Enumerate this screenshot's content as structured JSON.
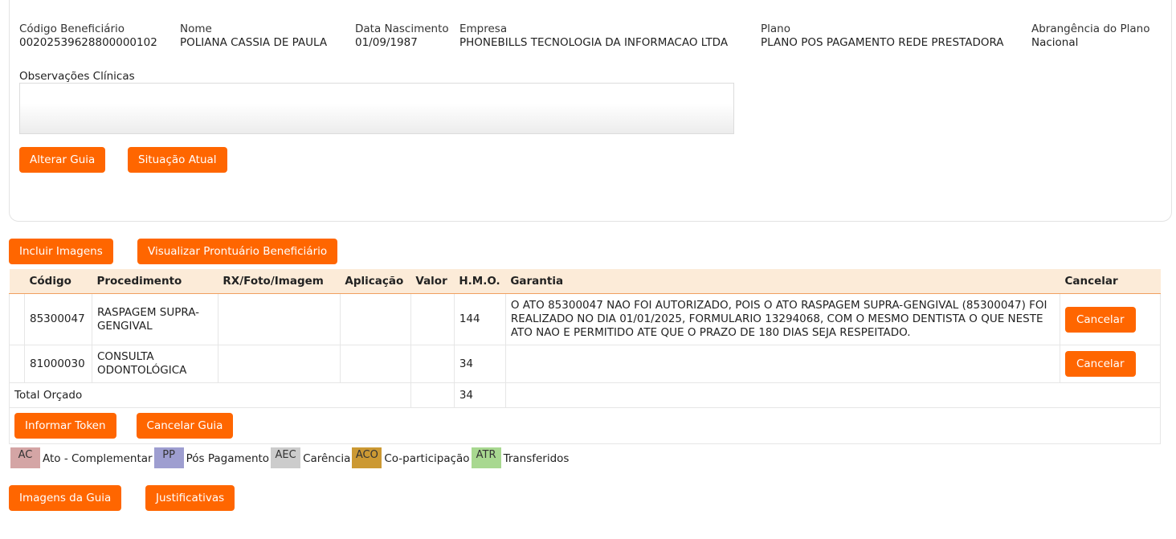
{
  "beneficiary": {
    "codigo": {
      "label": "Código Beneficiário",
      "value": "00202539628800000102"
    },
    "nome": {
      "label": "Nome",
      "value": "POLIANA CASSIA DE PAULA"
    },
    "nascimento": {
      "label": "Data Nascimento",
      "value": "01/09/1987"
    },
    "empresa": {
      "label": "Empresa",
      "value": "PHONEBILLS TECNOLOGIA DA INFORMACAO LTDA"
    },
    "plano": {
      "label": "Plano",
      "value": "PLANO POS PAGAMENTO REDE PRESTADORA"
    },
    "abrangencia": {
      "label": "Abrangência do Plano",
      "value": "Nacional"
    }
  },
  "observacoes": {
    "label": "Observações Clínicas",
    "value": ""
  },
  "card_buttons": {
    "alterar": "Alterar Guia",
    "situacao": "Situação Atual"
  },
  "top_buttons": {
    "incluir": "Incluir Imagens",
    "visualizar": "Visualizar Prontuário Beneficiário"
  },
  "table": {
    "headers": [
      "",
      "Código",
      "Procedimento",
      "RX/Foto/Imagem",
      "Aplicação",
      "Valor",
      "H.M.O.",
      "Garantia",
      "Cancelar"
    ],
    "rows": [
      {
        "codigo": "85300047",
        "procedimento": "RASPAGEM SUPRA-GENGIVAL",
        "rx": "",
        "aplicacao": "",
        "valor": "",
        "hmo": "144",
        "garantia": "O ATO 85300047 NAO FOI AUTORIZADO, POIS O ATO RASPAGEM SUPRA-GENGIVAL (85300047) FOI REALIZADO NO DIA 01/01/2025, FORMULARIO 13294068, COM O MESMO DENTISTA O QUE NESTE ATO NAO E PERMITIDO ATE QUE O PRAZO DE 180 DIAS SEJA RESPEITADO.",
        "cancel_label": "Cancelar"
      },
      {
        "codigo": "81000030",
        "procedimento": "CONSULTA ODONTOLÓGICA",
        "rx": "",
        "aplicacao": "",
        "valor": "",
        "hmo": "34",
        "garantia": "",
        "cancel_label": "Cancelar"
      }
    ],
    "total": {
      "label": "Total Orçado",
      "valor": "",
      "hmo": "34"
    },
    "bottom_buttons": {
      "token": "Informar Token",
      "cancelar_guia": "Cancelar Guia"
    }
  },
  "legend": [
    {
      "code": "AC",
      "label": "Ato - Complementar",
      "color": "#d4a5a5"
    },
    {
      "code": "PP",
      "label": "Pós Pagamento",
      "color": "#9e9ed0"
    },
    {
      "code": "AEC",
      "label": "Carência",
      "color": "#cccccc"
    },
    {
      "code": "ACO",
      "label": "Co-participação",
      "color": "#cc9933"
    },
    {
      "code": "ATR",
      "label": "Transferidos",
      "color": "#a8d890"
    }
  ],
  "footer_buttons": {
    "imagens": "Imagens da Guia",
    "justificativas": "Justificativas"
  }
}
